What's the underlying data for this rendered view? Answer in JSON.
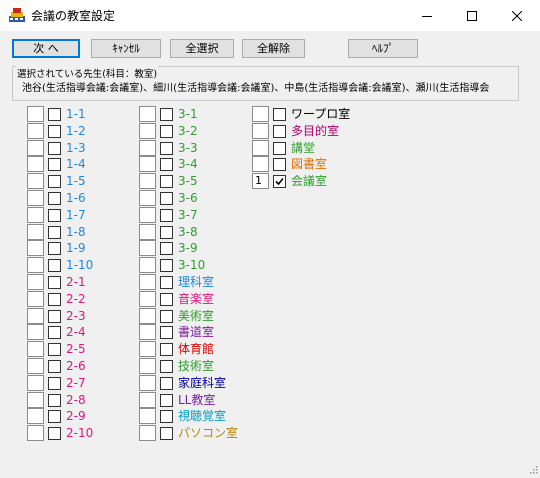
{
  "window": {
    "title": "会議の教室設定"
  },
  "toolbar": {
    "next_label": "次 へ",
    "cancel_label": "ｷｬﾝｾﾙ",
    "select_all_label": "全選択",
    "clear_all_label": "全解除",
    "help_label": "ﾍﾙﾌﾟ"
  },
  "selected_teachers": {
    "legend": "選択されている先生(科目：教室)",
    "text": "池谷(生活指導会議:会議室)、細川(生活指導会議:会議室)、中島(生活指導会議:会議室)、瀬川(生活指導会"
  },
  "colors": {
    "grade1": "#1e88e5",
    "grade2": "#e0177d",
    "grade3": "#2e9e2e",
    "rika": "#1e88e5",
    "ongaku": "#e0177d",
    "bijutsu": "#2e9e2e",
    "shodo": "#7b1fa2",
    "taiiku": "#e00000",
    "gijutsu": "#2e9e2e",
    "katei": "#0000a0",
    "ll": "#7b1fa2",
    "shichokaku": "#00a0c8",
    "pasokon": "#b8860b",
    "wapuro": "#000000",
    "tamokuteki": "#b0006a",
    "kodo": "#2e9e2e",
    "toshoshitsu": "#e07000",
    "kaigishitsu": "#2e9e2e"
  },
  "rooms": {
    "col1": [
      {
        "label": "1-1",
        "color": "grade1",
        "num": "",
        "checked": false
      },
      {
        "label": "1-2",
        "color": "grade1",
        "num": "",
        "checked": false
      },
      {
        "label": "1-3",
        "color": "grade1",
        "num": "",
        "checked": false
      },
      {
        "label": "1-4",
        "color": "grade1",
        "num": "",
        "checked": false
      },
      {
        "label": "1-5",
        "color": "grade1",
        "num": "",
        "checked": false
      },
      {
        "label": "1-6",
        "color": "grade1",
        "num": "",
        "checked": false
      },
      {
        "label": "1-7",
        "color": "grade1",
        "num": "",
        "checked": false
      },
      {
        "label": "1-8",
        "color": "grade1",
        "num": "",
        "checked": false
      },
      {
        "label": "1-9",
        "color": "grade1",
        "num": "",
        "checked": false
      },
      {
        "label": "1-10",
        "color": "grade1",
        "num": "",
        "checked": false
      },
      {
        "label": "2-1",
        "color": "grade2",
        "num": "",
        "checked": false
      },
      {
        "label": "2-2",
        "color": "grade2",
        "num": "",
        "checked": false
      },
      {
        "label": "2-3",
        "color": "grade2",
        "num": "",
        "checked": false
      },
      {
        "label": "2-4",
        "color": "grade2",
        "num": "",
        "checked": false
      },
      {
        "label": "2-5",
        "color": "grade2",
        "num": "",
        "checked": false
      },
      {
        "label": "2-6",
        "color": "grade2",
        "num": "",
        "checked": false
      },
      {
        "label": "2-7",
        "color": "grade2",
        "num": "",
        "checked": false
      },
      {
        "label": "2-8",
        "color": "grade2",
        "num": "",
        "checked": false
      },
      {
        "label": "2-9",
        "color": "grade2",
        "num": "",
        "checked": false
      },
      {
        "label": "2-10",
        "color": "grade2",
        "num": "",
        "checked": false
      }
    ],
    "col2": [
      {
        "label": "3-1",
        "color": "grade3",
        "num": "",
        "checked": false
      },
      {
        "label": "3-2",
        "color": "grade3",
        "num": "",
        "checked": false
      },
      {
        "label": "3-3",
        "color": "grade3",
        "num": "",
        "checked": false
      },
      {
        "label": "3-4",
        "color": "grade3",
        "num": "",
        "checked": false
      },
      {
        "label": "3-5",
        "color": "grade3",
        "num": "",
        "checked": false
      },
      {
        "label": "3-6",
        "color": "grade3",
        "num": "",
        "checked": false
      },
      {
        "label": "3-7",
        "color": "grade3",
        "num": "",
        "checked": false
      },
      {
        "label": "3-8",
        "color": "grade3",
        "num": "",
        "checked": false
      },
      {
        "label": "3-9",
        "color": "grade3",
        "num": "",
        "checked": false
      },
      {
        "label": "3-10",
        "color": "grade3",
        "num": "",
        "checked": false
      },
      {
        "label": "理科室",
        "color": "rika",
        "num": "",
        "checked": false
      },
      {
        "label": "音楽室",
        "color": "ongaku",
        "num": "",
        "checked": false
      },
      {
        "label": "美術室",
        "color": "bijutsu",
        "num": "",
        "checked": false
      },
      {
        "label": "書道室",
        "color": "shodo",
        "num": "",
        "checked": false
      },
      {
        "label": "体育館",
        "color": "taiiku",
        "num": "",
        "checked": false
      },
      {
        "label": "技術室",
        "color": "gijutsu",
        "num": "",
        "checked": false
      },
      {
        "label": "家庭科室",
        "color": "katei",
        "num": "",
        "checked": false
      },
      {
        "label": "LL教室",
        "color": "ll",
        "num": "",
        "checked": false
      },
      {
        "label": "視聴覚室",
        "color": "shichokaku",
        "num": "",
        "checked": false
      },
      {
        "label": "パソコン室",
        "color": "pasokon",
        "num": "",
        "checked": false
      }
    ],
    "col3": [
      {
        "label": "ワープロ室",
        "color": "wapuro",
        "num": "",
        "checked": false
      },
      {
        "label": "多目的室",
        "color": "tamokuteki",
        "num": "",
        "checked": false
      },
      {
        "label": "講堂",
        "color": "kodo",
        "num": "",
        "checked": false
      },
      {
        "label": "図書室",
        "color": "toshoshitsu",
        "num": "",
        "checked": false
      },
      {
        "label": "会議室",
        "color": "kaigishitsu",
        "num": "1",
        "checked": true
      }
    ]
  }
}
